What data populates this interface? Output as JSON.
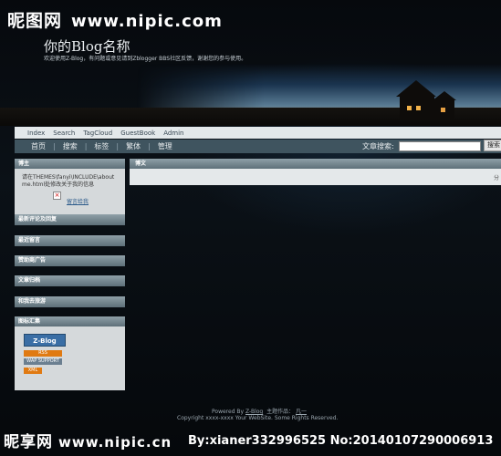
{
  "watermark": {
    "brand": "昵图网",
    "site": "www.nipic.com",
    "brand_bottom": "昵享网",
    "site_bottom": "www.nipic.cn",
    "id_text": "By:xianer332996525  No:20140107290006913"
  },
  "blog": {
    "title": "你的Blog名称",
    "subtitle": "欢迎使用Z-Blog，有问题或意见请到Zblogger BBS社区反馈，谢谢您的参与使用。"
  },
  "top_nav": [
    "Index",
    "Search",
    "TagCloud",
    "GuestBook",
    "Admin"
  ],
  "main_nav": [
    "首页",
    "搜索",
    "标签",
    "繁体",
    "管理"
  ],
  "search": {
    "label": "文章搜索:",
    "button": "搜索"
  },
  "sidebar": {
    "about_title": "博主",
    "about_text": "请在THEMES\\fanyi\\INCLUDE\\about me.html处修改关于我的信息",
    "message_link": "留言给我",
    "sections": [
      "最新评论及回复",
      "最近留言",
      "赞助商广告",
      "文章归档",
      "和我去旅游"
    ],
    "icons_title": "图标汇集",
    "badges": [
      {
        "label": "Z-Blog",
        "color": "#3a6ea5"
      },
      {
        "label": "RSS",
        "color": "#e07a12"
      },
      {
        "label": "WAP SUPPORT",
        "color": "#6b7f90"
      },
      {
        "label": "XML",
        "color": "#e07a12"
      }
    ]
  },
  "main": {
    "title": "博文",
    "pager": "分"
  },
  "footer": {
    "powered": "Powered By",
    "powered_link": "Z-Blog",
    "theme": "主题作品：",
    "theme_link": "凡一",
    "copyright": "Copyright xxxx-xxxx Your WebSite. Some Rights Reserved."
  }
}
